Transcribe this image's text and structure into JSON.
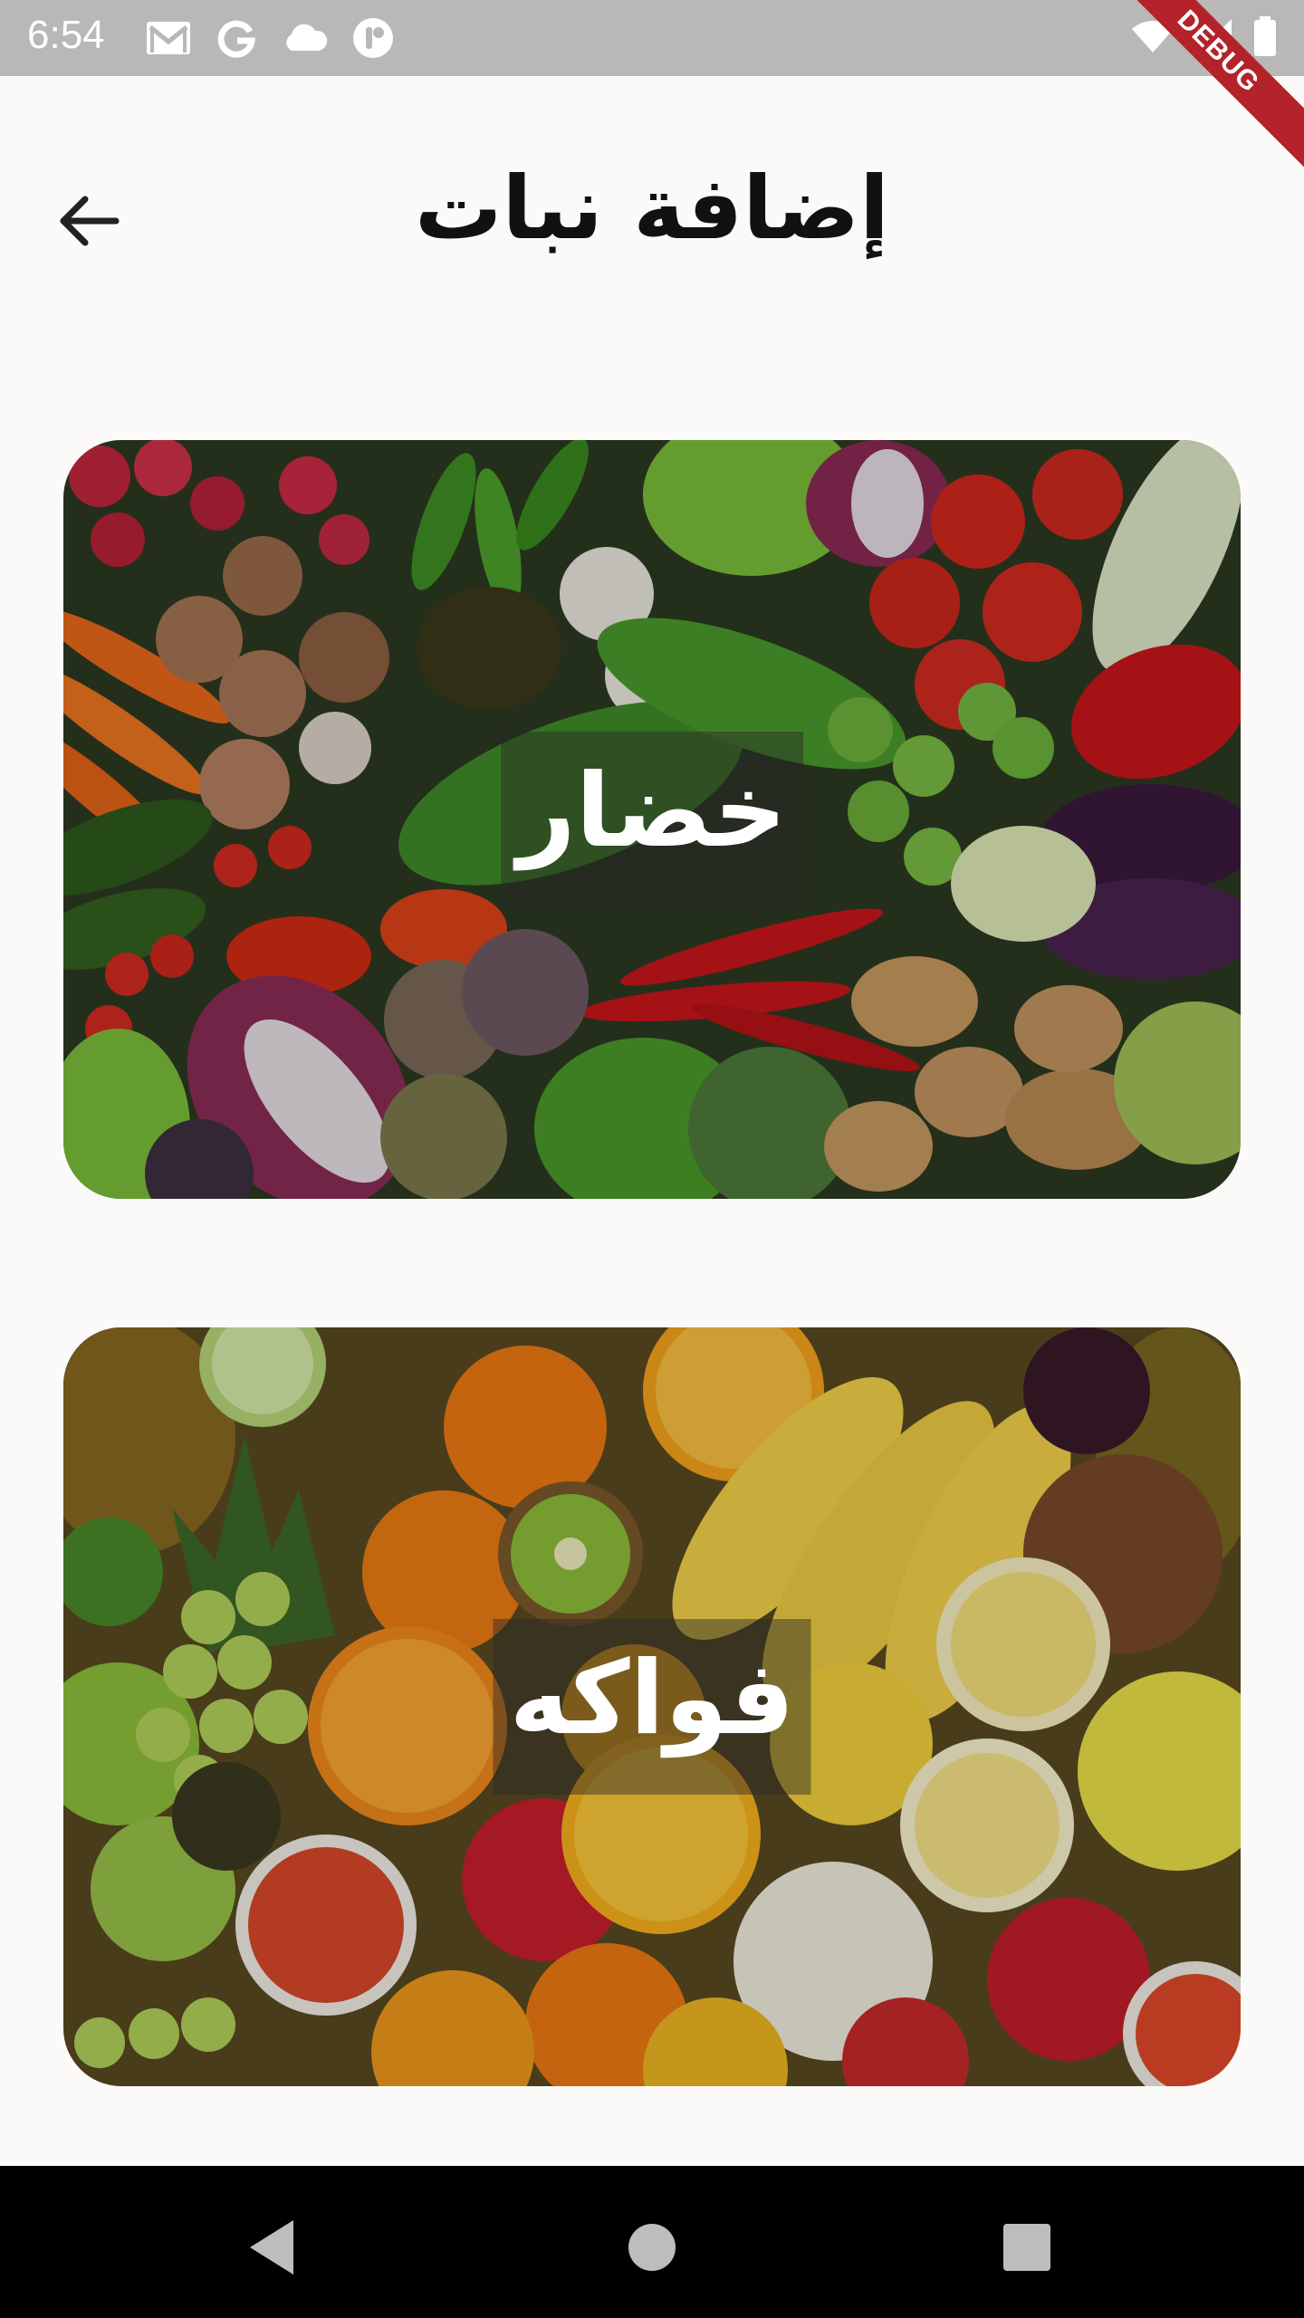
{
  "status_bar": {
    "time": "6:54",
    "left_icons": [
      "gmail-icon",
      "google-icon",
      "cloud-icon",
      "app-icon"
    ],
    "right_icons": [
      "wifi-icon",
      "signal-icon",
      "battery-icon"
    ],
    "debug_banner": "DEBUG"
  },
  "app_bar": {
    "title": "إضافة نبات",
    "back_icon": "arrow-back-icon"
  },
  "categories": [
    {
      "label": "خضار"
    },
    {
      "label": "فواكه"
    }
  ],
  "nav_bar": {
    "buttons": [
      "back-triangle-icon",
      "home-circle-icon",
      "recents-square-icon"
    ]
  }
}
